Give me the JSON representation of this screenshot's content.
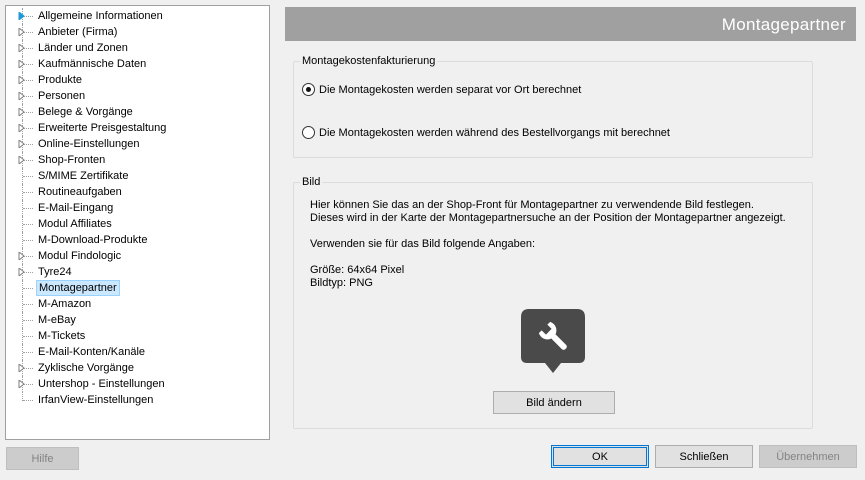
{
  "tree": {
    "items": [
      {
        "label": "Allgemeine Informationen",
        "expandable": true,
        "highlight": true
      },
      {
        "label": "Anbieter (Firma)",
        "expandable": true
      },
      {
        "label": "Länder und Zonen",
        "expandable": true
      },
      {
        "label": "Kaufmännische Daten",
        "expandable": true
      },
      {
        "label": "Produkte",
        "expandable": true
      },
      {
        "label": "Personen",
        "expandable": true
      },
      {
        "label": "Belege & Vorgänge",
        "expandable": true
      },
      {
        "label": "Erweiterte Preisgestaltung",
        "expandable": true
      },
      {
        "label": "Online-Einstellungen",
        "expandable": true
      },
      {
        "label": "Shop-Fronten",
        "expandable": true
      },
      {
        "label": "S/MIME Zertifikate",
        "expandable": false
      },
      {
        "label": "Routineaufgaben",
        "expandable": false
      },
      {
        "label": "E-Mail-Eingang",
        "expandable": false
      },
      {
        "label": "Modul Affiliates",
        "expandable": false
      },
      {
        "label": "M-Download-Produkte",
        "expandable": false
      },
      {
        "label": "Modul Findologic",
        "expandable": true
      },
      {
        "label": "Tyre24",
        "expandable": true
      },
      {
        "label": "Montagepartner",
        "expandable": false,
        "selected": true
      },
      {
        "label": "M-Amazon",
        "expandable": false
      },
      {
        "label": "M-eBay",
        "expandable": false
      },
      {
        "label": "M-Tickets",
        "expandable": false
      },
      {
        "label": "E-Mail-Konten/Kanäle",
        "expandable": false
      },
      {
        "label": "Zyklische Vorgänge",
        "expandable": true
      },
      {
        "label": "Untershop - Einstellungen",
        "expandable": true
      },
      {
        "label": "IrfanView-Einstellungen",
        "expandable": false
      }
    ]
  },
  "header": {
    "title": "Montagepartner"
  },
  "billing": {
    "title": "Montagekostenfakturierung",
    "option_onsite": "Die Montagekosten werden separat vor Ort berechnet",
    "option_order": "Die Montagekosten werden während des Bestellvorgangs mit berechnet",
    "selected": "onsite"
  },
  "image": {
    "title": "Bild",
    "line1": "Hier können Sie das an der Shop-Front für Montagepartner zu verwendende Bild festlegen.",
    "line2": "Dieses wird in der Karte der Montagepartnersuche an der Position der Montagepartner angezeigt.",
    "line3": "Verwenden sie für das Bild folgende Angaben:",
    "size": "Größe:  64x64 Pixel",
    "type": "Bildtyp: PNG",
    "icon": "wrench-map-marker-icon",
    "change_button": "Bild ändern"
  },
  "footer": {
    "help": "Hilfe",
    "ok": "OK",
    "close": "Schließen",
    "apply": "Übernehmen"
  },
  "colors": {
    "header_bg": "#a0a0a0",
    "selection_bg": "#cce8ff",
    "accent": "#0078d7",
    "marker_fill": "#4a4a4a",
    "expander_active": "#1e9ad6"
  }
}
